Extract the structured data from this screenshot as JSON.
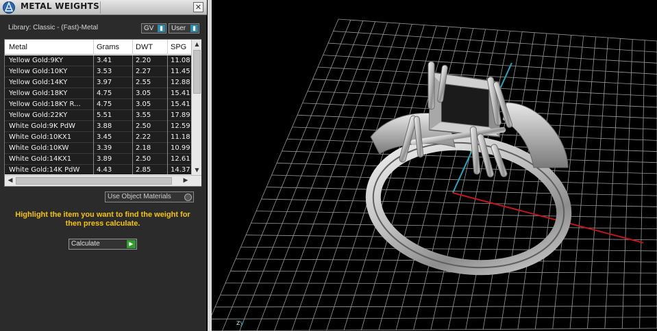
{
  "panel": {
    "title": "METAL WEIGHTS",
    "close_label": "✕",
    "library_label": "Library: Classic - (Fast)-Metal",
    "gv_label": "GV",
    "user_label": "User",
    "columns": [
      "Metal",
      "Grams",
      "DWT",
      "SPG"
    ],
    "rows": [
      {
        "metal": "Yellow Gold:9KY",
        "grams": "3.41",
        "dwt": "2.20",
        "spg": "11.08"
      },
      {
        "metal": "Yellow Gold:10KY",
        "grams": "3.53",
        "dwt": "2.27",
        "spg": "11.45"
      },
      {
        "metal": "Yellow Gold:14KY",
        "grams": "3.97",
        "dwt": "2.55",
        "spg": "12.88"
      },
      {
        "metal": "Yellow Gold:18KY",
        "grams": "4.75",
        "dwt": "3.05",
        "spg": "15.41"
      },
      {
        "metal": "Yellow Gold:18KY R...",
        "grams": "4.75",
        "dwt": "3.05",
        "spg": "15.41"
      },
      {
        "metal": "Yellow Gold:22KY",
        "grams": "5.51",
        "dwt": "3.55",
        "spg": "17.89"
      },
      {
        "metal": "White Gold:9K PdW",
        "grams": "3.88",
        "dwt": "2.50",
        "spg": "12.59"
      },
      {
        "metal": "White Gold:10KX1",
        "grams": "3.45",
        "dwt": "2.22",
        "spg": "11.18"
      },
      {
        "metal": "White Gold:10KW",
        "grams": "3.39",
        "dwt": "2.18",
        "spg": "10.99"
      },
      {
        "metal": "White Gold:14KX1",
        "grams": "3.89",
        "dwt": "2.50",
        "spg": "12.61"
      },
      {
        "metal": "White Gold:14K PdW",
        "grams": "4.43",
        "dwt": "2.85",
        "spg": "14.37"
      }
    ],
    "use_object_materials": "Use Object Materials",
    "instruction": "Highlight the item you want to find the weight for then press calculate.",
    "calculate_label": "Calculate"
  },
  "viewport": {
    "axis_z": "z",
    "axis_y": "y",
    "colors": {
      "grid": "#9a9a9a",
      "x_axis": "#c0181a",
      "y_axis": "#2aa7c0",
      "instruction": "#f5c400"
    }
  }
}
